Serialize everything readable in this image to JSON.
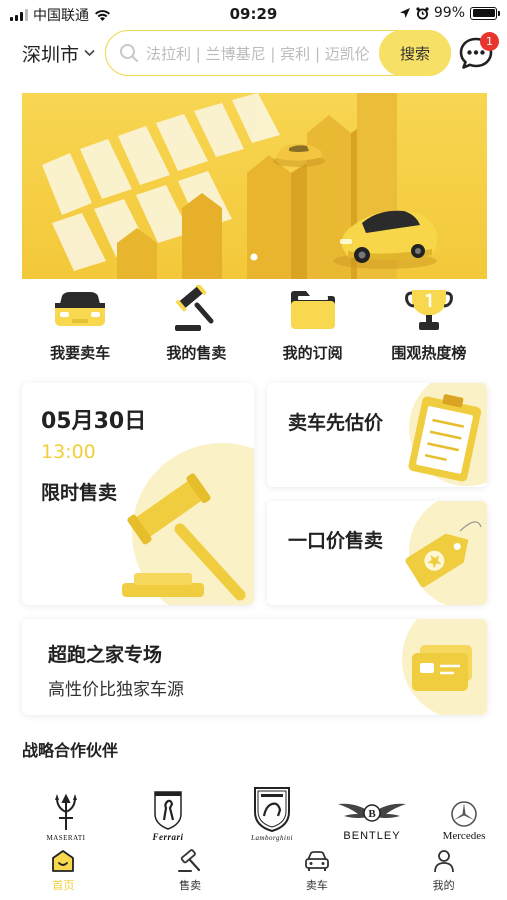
{
  "status_bar": {
    "carrier": "中国联通",
    "time": "09:29",
    "battery": "99%"
  },
  "header": {
    "city": "深圳市",
    "search_placeholder": "法拉利 | 兰博基尼 | 宾利 | 迈凯伦",
    "search_button": "搜索",
    "message_badge": "1"
  },
  "quick_nav": [
    {
      "label": "我要卖车",
      "icon": "car-front-icon"
    },
    {
      "label": "我的售卖",
      "icon": "gavel-icon"
    },
    {
      "label": "我的订阅",
      "icon": "folder-icon"
    },
    {
      "label": "围观热度榜",
      "icon": "trophy-icon"
    }
  ],
  "flash_sale": {
    "date": "05月30日",
    "time": "13:00",
    "title": "限时售卖"
  },
  "estimate": {
    "title": "卖车先估价"
  },
  "fixed_price": {
    "title": "一口价售卖"
  },
  "supercar": {
    "title": "超跑之家专场",
    "subtitle": "高性价比独家车源"
  },
  "partners": {
    "title": "战略合作伙伴",
    "brands": [
      "MASERATI",
      "Ferrari",
      "Lamborghini",
      "BENTLEY",
      "Mercedes"
    ]
  },
  "tabbar": [
    {
      "label": "首页",
      "icon": "home-icon",
      "active": true
    },
    {
      "label": "售卖",
      "icon": "gavel-icon",
      "active": false
    },
    {
      "label": "卖车",
      "icon": "car-icon",
      "active": false
    },
    {
      "label": "我的",
      "icon": "person-icon",
      "active": false
    }
  ],
  "colors": {
    "accent": "#f7e066",
    "accent_text": "#f0cf3a",
    "badge": "#e8362f"
  }
}
